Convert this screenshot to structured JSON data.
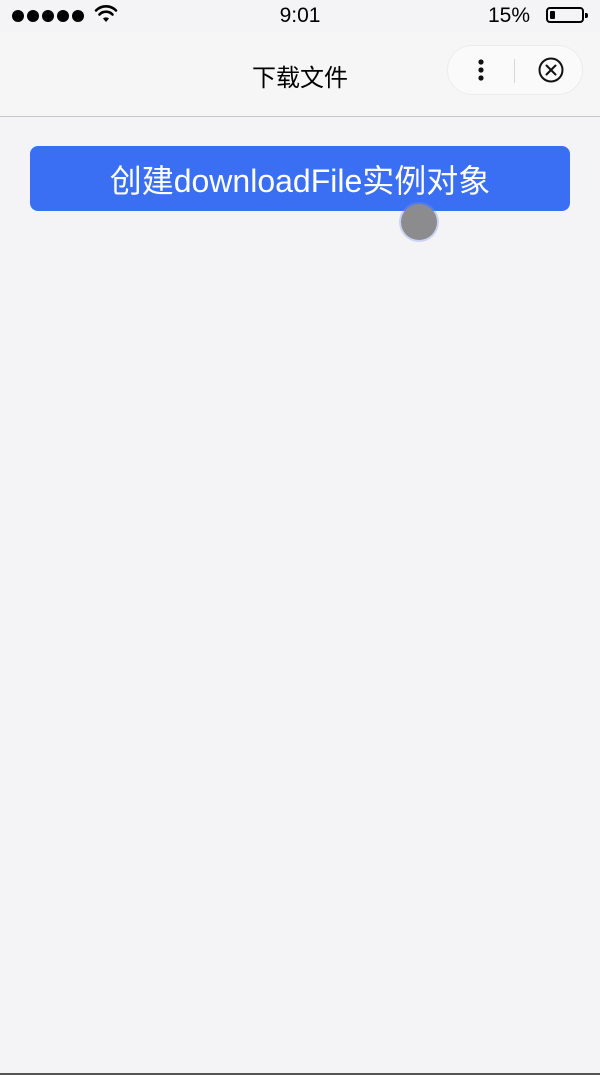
{
  "status_bar": {
    "time": "9:01",
    "battery_text": "15%",
    "battery_level": 0.15,
    "signal_icon": "signal-dots-icon",
    "wifi_icon": "wifi-icon",
    "battery_icon": "battery-icon"
  },
  "nav_bar": {
    "title": "下载文件",
    "more_icon": "more-dots-icon",
    "close_icon": "close-circle-icon"
  },
  "main": {
    "create_button_label": "创建downloadFile实例对象"
  },
  "colors": {
    "accent": "#3a6ff4",
    "background": "#f4f3f6"
  }
}
